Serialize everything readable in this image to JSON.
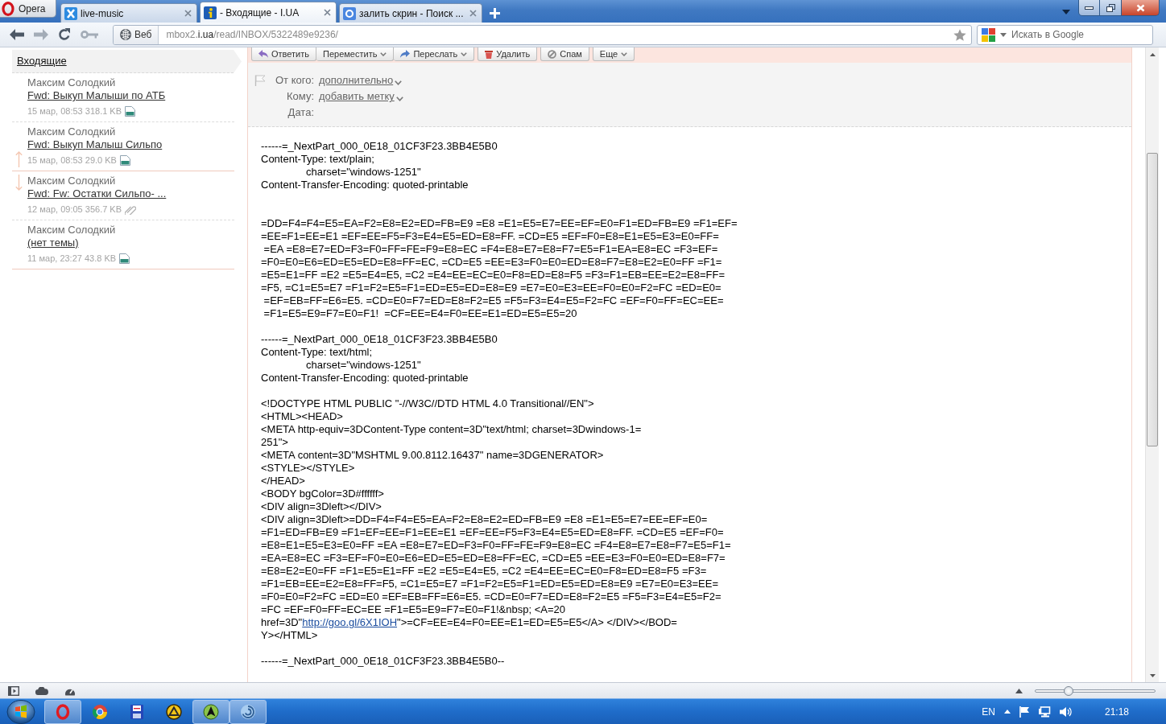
{
  "browser": {
    "menu_button": {
      "label": "Opera"
    },
    "tabs": [
      {
        "title": "live-music",
        "kind": "cross",
        "selected": false
      },
      {
        "title": "- Входящие - I.UA",
        "kind": "info",
        "selected": true
      },
      {
        "title": "залить скрин - Поиск ...",
        "kind": "search",
        "selected": false
      }
    ],
    "nav_buttons": [
      {
        "kind": "back",
        "disabled": false
      },
      {
        "kind": "forward",
        "disabled": true
      },
      {
        "kind": "reload",
        "disabled": false
      },
      {
        "kind": "key",
        "disabled": true
      }
    ],
    "site_button": {
      "label": "Веб"
    },
    "address": {
      "subdomain": "mbox2.",
      "domain": "i.ua",
      "path": "/read/INBOX/5322489e9236/"
    },
    "search": {
      "placeholder": "Искать в Google"
    }
  },
  "mail": {
    "folder": {
      "label": "Входящие"
    },
    "messages": [
      {
        "sender": "Максим Солодкий",
        "subject": "Fwd: Выкуп Малыши по АТБ",
        "meta": "15 мар, 08:53 318.1 KB",
        "attachment": {
          "kind": "xls"
        },
        "arrow_up": false,
        "arrow_down": false,
        "solid_divider": false
      },
      {
        "sender": "Максим Солодкий",
        "subject": "Fwd: Выкуп Малыш Сильпо",
        "meta": "15 мар, 08:53 29.0 KB",
        "attachment": {
          "kind": "xls"
        },
        "arrow_up": true,
        "arrow_down": false,
        "solid_divider": true
      },
      {
        "sender": "Максим Солодкий",
        "subject": "Fwd: Fw: Остатки Сильпо- ...",
        "meta": "12 мар, 09:05 356.7 KB",
        "attachment": {
          "kind": "clip"
        },
        "arrow_up": false,
        "arrow_down": true,
        "solid_divider": false
      },
      {
        "sender": "Максим Солодкий",
        "subject": "(нет темы)",
        "meta": "11 мар, 23:27 43.8 KB",
        "attachment": {
          "kind": "xls"
        },
        "arrow_up": false,
        "arrow_down": false,
        "solid_divider": true
      }
    ],
    "toolbar": [
      [
        {
          "label": "Ответить",
          "kind": "reply",
          "dropdown": false
        },
        {
          "label": "Переместить",
          "kind": "plain",
          "dropdown": true
        },
        {
          "label": "Переслать",
          "kind": "forward",
          "dropdown": true
        }
      ],
      [
        {
          "label": "Удалить",
          "kind": "trash",
          "dropdown": false
        }
      ],
      [
        {
          "label": "Спам",
          "kind": "spam",
          "dropdown": false
        }
      ],
      [
        {
          "label": "Еще",
          "kind": "plain",
          "dropdown": true
        }
      ]
    ],
    "header": {
      "flagged": false,
      "fields": [
        {
          "label": "От кого:",
          "link": "дополнительно",
          "dropdown": true
        },
        {
          "label": "Кому:",
          "link": "добавить метку",
          "dropdown": true
        },
        {
          "label": "Дата:"
        }
      ]
    },
    "body": [
      {
        "parts": [
          {
            "kind": "text",
            "text": "------=_NextPart_000_0E18_01CF3F23.3BB4E5B0\nContent-Type: text/plain;\n\tcharset=\"windows-1251\"\nContent-Transfer-Encoding: quoted-printable\n\n\n=DD=F4=F4=E5=EA=F2=E8=E2=ED=FB=E9 =E8 =E1=E5=E7=EE=EF=E0=F1=ED=FB=E9 =F1=EF=\n=EE=F1=EE=E1 =EF=EE=F5=F3=E4=E5=ED=E8=FF. =CD=E5 =EF=F0=E8=E1=E5=E3=E0=FF=\n =EA =E8=E7=ED=F3=F0=FF=FE=F9=E8=EC =F4=E8=E7=E8=F7=E5=F1=EA=E8=EC =F3=EF=\n=F0=E0=E6=ED=E5=ED=E8=FF=EC, =CD=E5 =EE=E3=F0=E0=ED=E8=F7=E8=E2=E0=FF =F1=\n=E5=E1=FF =E2 =E5=E4=E5, =C2 =E4=EE=EC=E0=F8=ED=E8=F5 =F3=F1=EB=EE=E2=E8=FF=\n=F5, =C1=E5=E7 =F1=F2=E5=F1=ED=E5=ED=E8=E9 =E7=E0=E3=EE=F0=E0=F2=FC =ED=E0=\n =EF=EB=FF=E6=E5. =CD=E0=F7=ED=E8=F2=E5 =F5=F3=E4=E5=F2=FC =EF=F0=FF=EC=EE=\n =F1=E5=E9=F7=E0=F1!  =CF=EE=E4=F0=EE=E1=ED=E5=E5=20"
          }
        ]
      },
      {
        "parts": [
          {
            "kind": "text",
            "text": "------=_NextPart_000_0E18_01CF3F23.3BB4E5B0\nContent-Type: text/html;\n\tcharset=\"windows-1251\"\nContent-Transfer-Encoding: quoted-printable"
          }
        ]
      },
      {
        "parts": [
          {
            "kind": "text",
            "text": "<!DOCTYPE HTML PUBLIC \"-//W3C//DTD HTML 4.0 Transitional//EN\">\n<HTML><HEAD>\n<META http-equiv=3DContent-Type content=3D\"text/html; charset=3Dwindows-1=\n251\">\n<META content=3D\"MSHTML 9.00.8112.16437\" name=3DGENERATOR>\n<STYLE></STYLE>\n</HEAD>\n<BODY bgColor=3D#ffffff>\n<DIV align=3Dleft></DIV>\n<DIV align=3Dleft>=DD=F4=F4=E5=EA=F2=E8=E2=ED=FB=E9 =E8 =E1=E5=E7=EE=EF=E0=\n=F1=ED=FB=E9 =F1=EF=EE=F1=EE=E1 =EF=EE=F5=F3=E4=E5=ED=E8=FF. =CD=E5 =EF=F0=\n=E8=E1=E5=E3=E0=FF =EA =E8=E7=ED=F3=F0=FF=FE=F9=E8=EC =F4=E8=E7=E8=F7=E5=F1=\n=EA=E8=EC =F3=EF=F0=E0=E6=ED=E5=ED=E8=FF=EC, =CD=E5 =EE=E3=F0=E0=ED=E8=F7=\n=E8=E2=E0=FF =F1=E5=E1=FF =E2 =E5=E4=E5, =C2 =E4=EE=EC=E0=F8=ED=E8=F5 =F3=\n=F1=EB=EE=E2=E8=FF=F5, =C1=E5=E7 =F1=F2=E5=F1=ED=E5=ED=E8=E9 =E7=E0=E3=EE=\n=F0=E0=F2=FC =ED=E0 =EF=EB=FF=E6=E5. =CD=E0=F7=ED=E8=F2=E5 =F5=F3=E4=E5=F2=\n=FC =EF=F0=FF=EC=EE =F1=E5=E9=F7=E0=F1!&nbsp; <A=20\nhref=3D\""
          },
          {
            "kind": "link",
            "text": "http://goo.gl/6X1IOH"
          },
          {
            "kind": "text",
            "text": "\">=CF=EE=E4=F0=EE=E1=ED=E5=E5</A> </DIV></BOD=\nY></HTML>"
          }
        ]
      },
      {
        "parts": [
          {
            "kind": "text",
            "text": "------=_NextPart_000_0E18_01CF3F23.3BB4E5B0--"
          }
        ]
      }
    ]
  },
  "status_bar": {
    "zoom": {
      "level": 0.28
    }
  },
  "taskbar": {
    "apps": [
      {
        "kind": "ring",
        "running": true
      },
      {
        "kind": "wheel",
        "running": false
      },
      {
        "kind": "floppy",
        "running": false
      },
      {
        "kind": "triangle",
        "running": false
      },
      {
        "kind": "compass",
        "running": true
      },
      {
        "kind": "swirl",
        "running": true
      }
    ],
    "language": "EN",
    "clock": "21:18"
  }
}
